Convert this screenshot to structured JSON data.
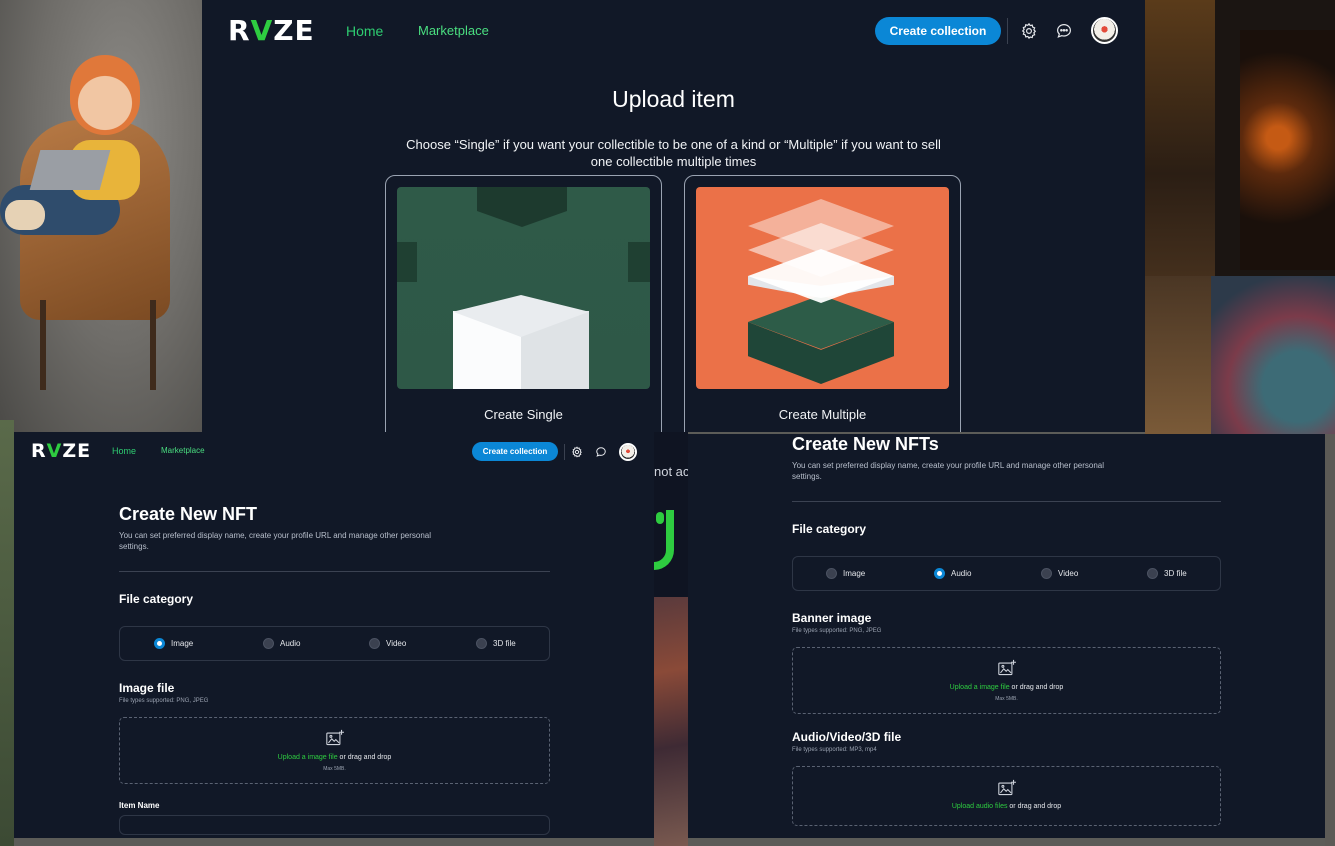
{
  "brand": {
    "logo_text": "RVZE",
    "accent": "#2ecc40",
    "bg": "#111827",
    "button": "#0b87d6"
  },
  "nav": {
    "home": "Home",
    "marketplace": "Marketplace",
    "create_collection": "Create collection",
    "icons": [
      "gear-icon",
      "chat-icon",
      "avatar"
    ]
  },
  "upload": {
    "title": "Upload item",
    "subtitle": "Choose “Single” if you want your collectible to be one of a kind or “Multiple” if you want to sell one collectible multiple times",
    "single_label": "Create Single",
    "multiple_label": "Create Multiple"
  },
  "background": {
    "partial_text": "not ac"
  },
  "form_single": {
    "title": "Create New NFT",
    "subtitle": "You can set preferred display name, create your profile URL and manage other personal settings.",
    "file_category": "File category",
    "categories": [
      "Image",
      "Audio",
      "Video",
      "3D file"
    ],
    "selected": "Image",
    "image_file": "Image file",
    "types": "File types supported: PNG, JPEG",
    "upload_link": "Upload a image file",
    "upload_rest": " or drag and drop",
    "max": "Max 5MB.",
    "item_name": "Item Name"
  },
  "form_multi": {
    "title": "Create New NFTs",
    "subtitle": "You can set preferred display name, create your profile URL and manage other personal settings.",
    "file_category": "File category",
    "categories": [
      "Image",
      "Audio",
      "Video",
      "3D file"
    ],
    "selected": "Audio",
    "banner": "Banner image",
    "banner_types": "File types supported: PNG, JPEG",
    "banner_link": "Upload a image file",
    "banner_rest": " or drag and drop",
    "banner_max": "Max 5MB.",
    "media": "Audio/Video/3D file",
    "media_types": "File types supported: MP3, mp4",
    "media_link": "Upload audio files",
    "media_rest": " or drag and drop"
  }
}
